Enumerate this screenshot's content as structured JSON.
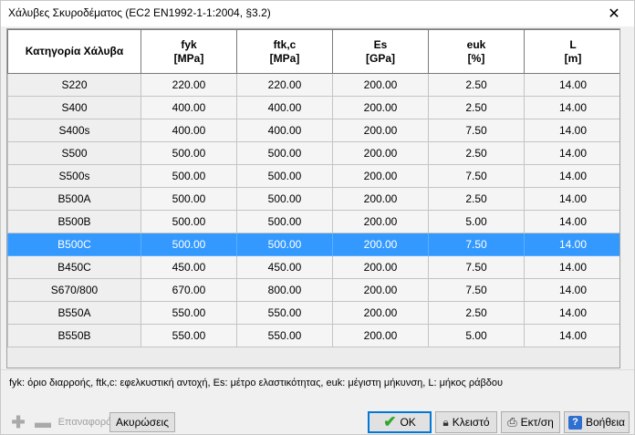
{
  "window": {
    "title": "Χάλυβες Σκυροδέματος (EC2 EN1992-1-1:2004, §3.2)",
    "close_glyph": "✕"
  },
  "table": {
    "headers": [
      {
        "label": "Κατηγορία Χάλυβα",
        "unit": ""
      },
      {
        "label": "fyk",
        "unit": "[MPa]"
      },
      {
        "label": "ftk,c",
        "unit": "[MPa]"
      },
      {
        "label": "Es",
        "unit": "[GPa]"
      },
      {
        "label": "euk",
        "unit": "[%]"
      },
      {
        "label": "L",
        "unit": "[m]"
      }
    ],
    "rows": [
      [
        "S220",
        "220.00",
        "220.00",
        "200.00",
        "2.50",
        "14.00"
      ],
      [
        "S400",
        "400.00",
        "400.00",
        "200.00",
        "2.50",
        "14.00"
      ],
      [
        "S400s",
        "400.00",
        "400.00",
        "200.00",
        "7.50",
        "14.00"
      ],
      [
        "S500",
        "500.00",
        "500.00",
        "200.00",
        "2.50",
        "14.00"
      ],
      [
        "S500s",
        "500.00",
        "500.00",
        "200.00",
        "7.50",
        "14.00"
      ],
      [
        "B500A",
        "500.00",
        "500.00",
        "200.00",
        "2.50",
        "14.00"
      ],
      [
        "B500B",
        "500.00",
        "500.00",
        "200.00",
        "5.00",
        "14.00"
      ],
      [
        "B500C",
        "500.00",
        "500.00",
        "200.00",
        "7.50",
        "14.00"
      ],
      [
        "B450C",
        "450.00",
        "450.00",
        "200.00",
        "7.50",
        "14.00"
      ],
      [
        "S670/800",
        "670.00",
        "800.00",
        "200.00",
        "7.50",
        "14.00"
      ],
      [
        "B550A",
        "550.00",
        "550.00",
        "200.00",
        "2.50",
        "14.00"
      ],
      [
        "B550B",
        "550.00",
        "550.00",
        "200.00",
        "5.00",
        "14.00"
      ]
    ],
    "selected_row": 7,
    "selection_color": "#3399ff"
  },
  "legend": "fyk: όριο διαρροής, ftk,c: εφελκυστική αντοχή, Es: μέτρο ελαστικότητας, euk: μέγιστη μήκυνση, L: μήκος ράβδου",
  "toolbar": {
    "add_glyph": "✚",
    "remove_glyph": "▬",
    "restore_label": "Επαναφορά",
    "cancel_edits_label": "Ακυρώσεις"
  },
  "buttons": {
    "ok_label": "OK",
    "closed_label": "Κλειστό",
    "print_label": "Εκτ/ση",
    "help_label": "Βοήθεια"
  },
  "icons": {
    "ok": "check-icon",
    "closed": "lock-icon",
    "print": "printer-icon",
    "help": "help-icon"
  }
}
